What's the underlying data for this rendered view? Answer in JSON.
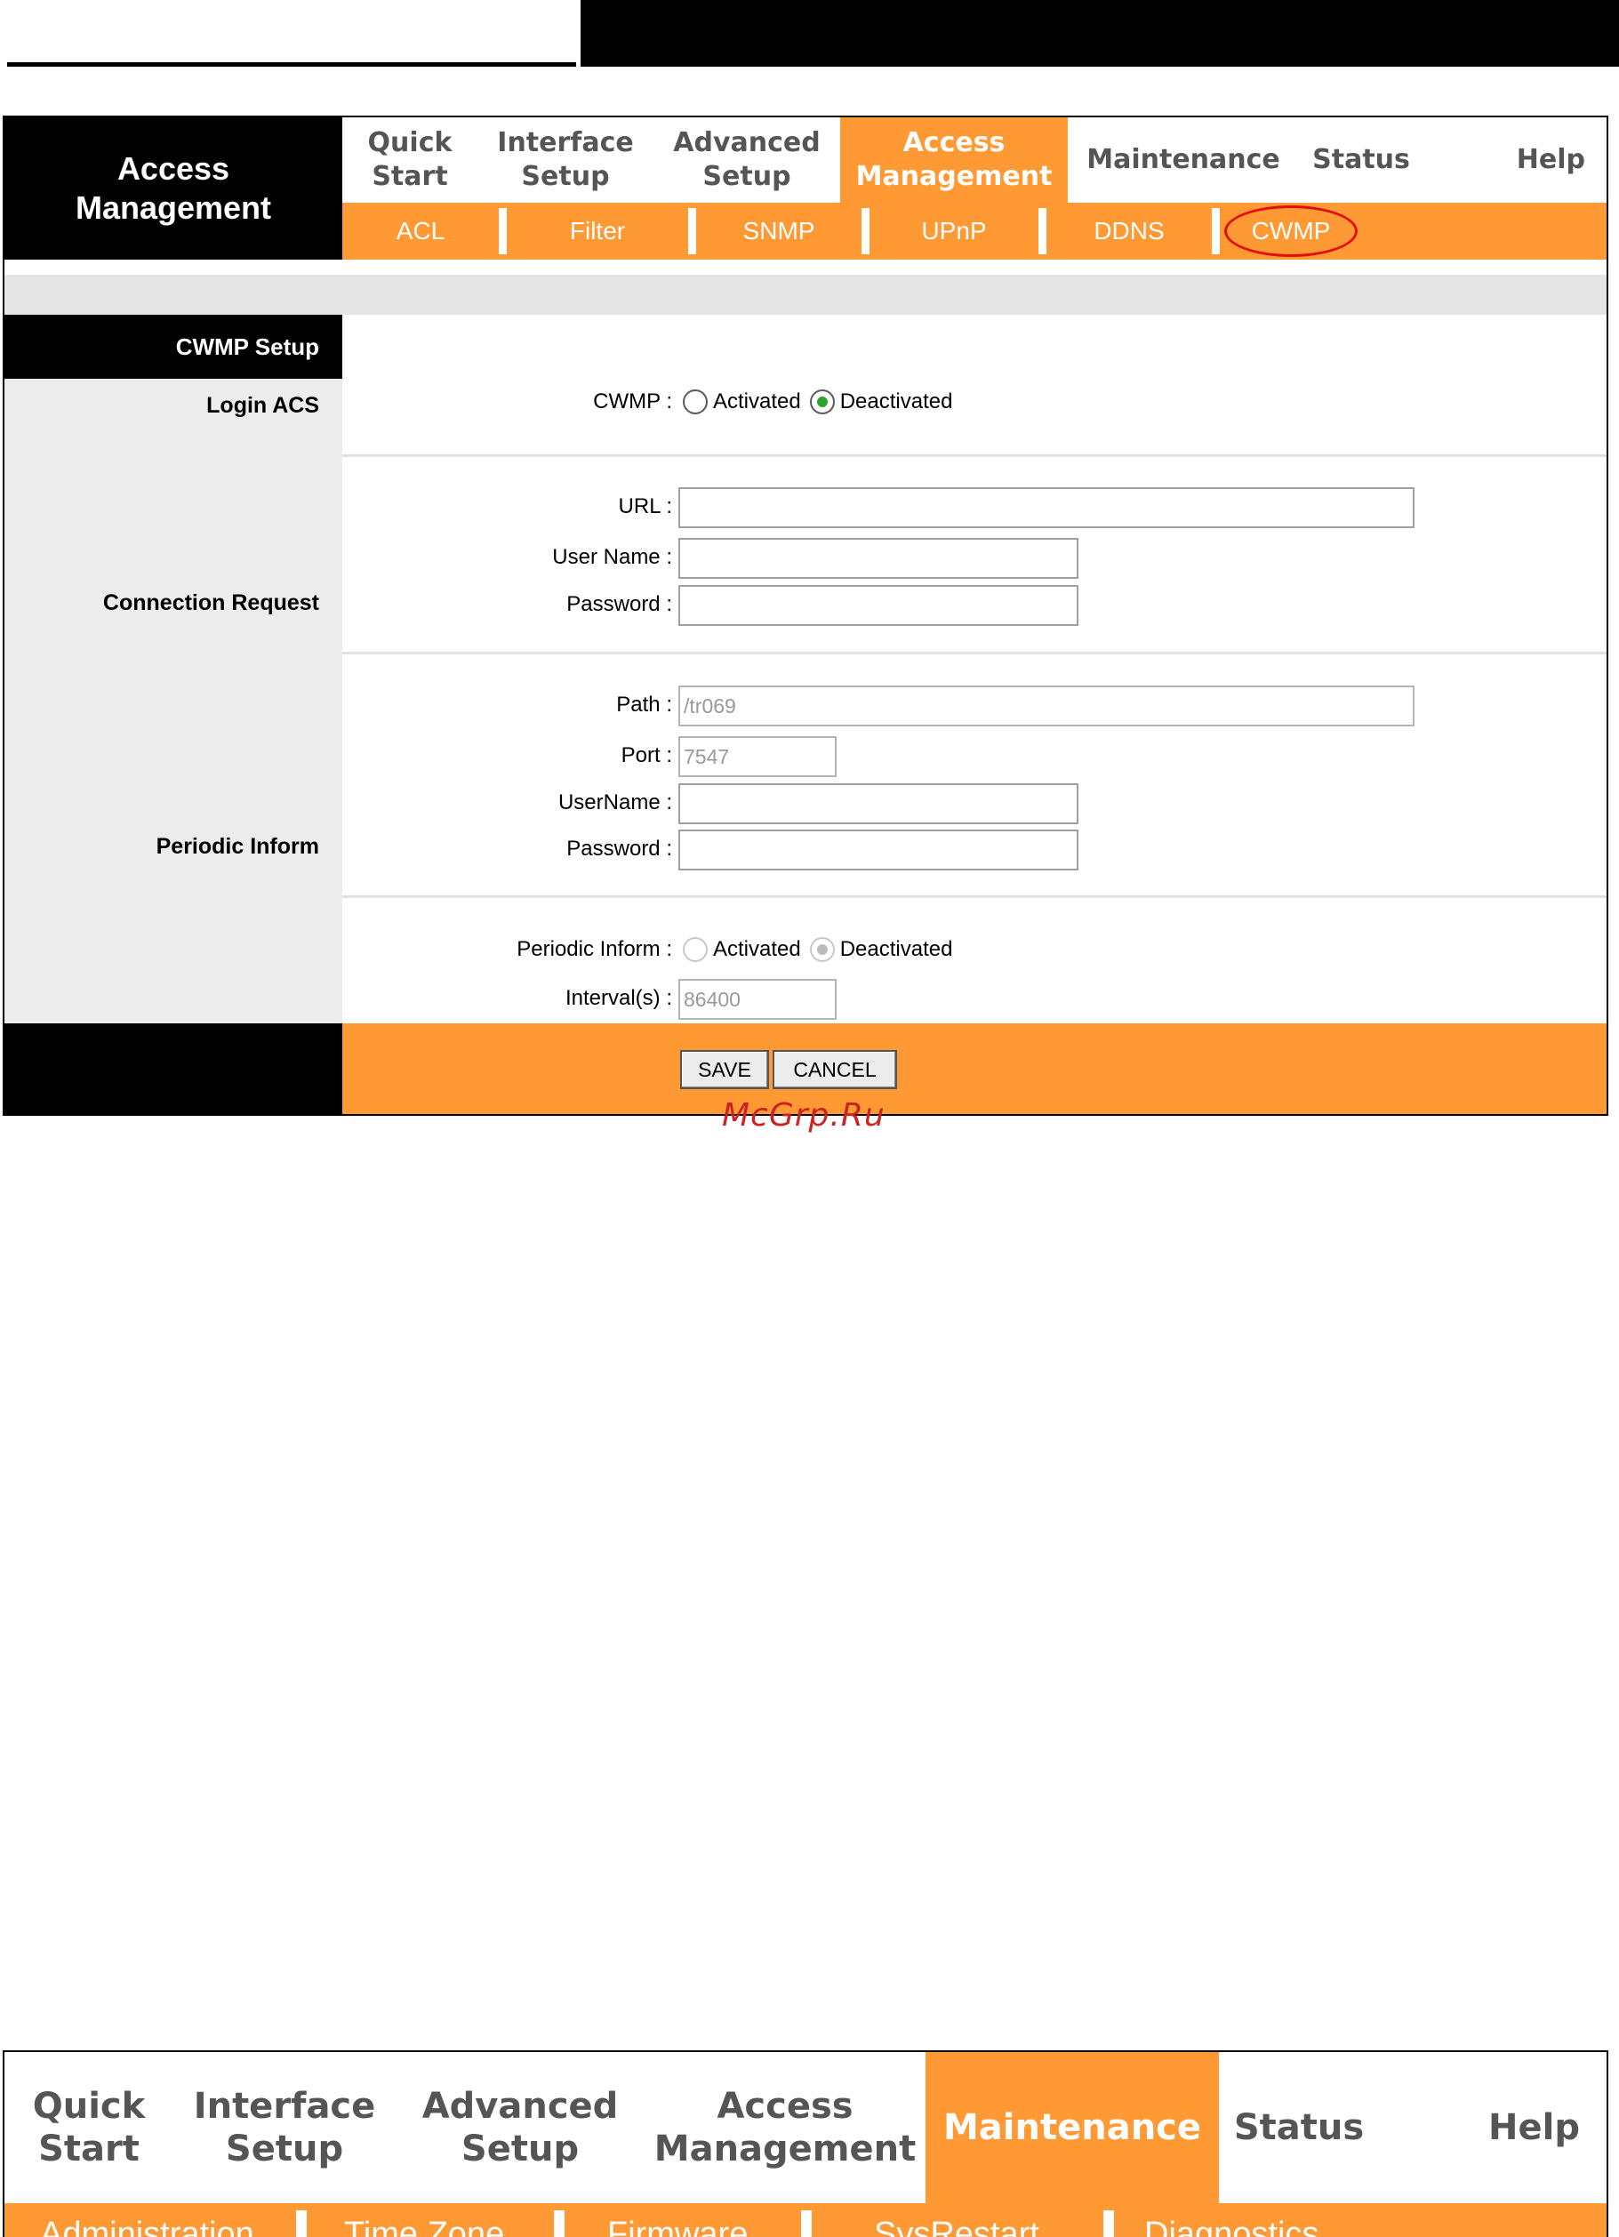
{
  "colors": {
    "accent": "#ff9933",
    "header_black": "#000000",
    "panel_gray": "#ececec",
    "highlight_circle": "#e01010",
    "watermark": "#cc2222"
  },
  "screen1": {
    "brand": {
      "line1": "Access",
      "line2": "Management"
    },
    "main_tabs": [
      {
        "line1": "Quick",
        "line2": "Start"
      },
      {
        "line1": "Interface",
        "line2": "Setup"
      },
      {
        "line1": "Advanced",
        "line2": "Setup"
      },
      {
        "line1": "Access",
        "line2": "Management",
        "active": true
      },
      {
        "line1": "Maintenance",
        "line2": ""
      },
      {
        "line1": "Status",
        "line2": ""
      },
      {
        "line1": "Help",
        "line2": ""
      }
    ],
    "sub_tabs": [
      "ACL",
      "Filter",
      "SNMP",
      "UPnP",
      "DDNS",
      "CWMP"
    ],
    "active_sub_tab": "CWMP",
    "panel_title": "CWMP Setup",
    "cwmp": {
      "label": "CWMP :",
      "options": [
        "Activated",
        "Deactivated"
      ],
      "selected": "Deactivated"
    },
    "login_acs": {
      "section": "Login ACS",
      "url_label": "URL :",
      "url_value": "",
      "username_label": "User Name :",
      "username_value": "",
      "password_label": "Password :",
      "password_value": ""
    },
    "connection_request": {
      "section": "Connection Request",
      "path_label": "Path :",
      "path_value": "/tr069",
      "port_label": "Port :",
      "port_value": "7547",
      "username_label": "UserName :",
      "username_value": "",
      "password_label": "Password :",
      "password_value": ""
    },
    "periodic_inform": {
      "section": "Periodic Inform",
      "label": "Periodic Inform :",
      "options": [
        "Activated",
        "Deactivated"
      ],
      "selected": "Deactivated",
      "interval_label": "Interval(s) :",
      "interval_value": "86400"
    },
    "buttons": {
      "save": "SAVE",
      "cancel": "CANCEL"
    }
  },
  "watermark": "McGrp.Ru",
  "screen2": {
    "main_tabs": [
      {
        "line1": "Quick",
        "line2": "Start"
      },
      {
        "line1": "Interface",
        "line2": "Setup"
      },
      {
        "line1": "Advanced",
        "line2": "Setup"
      },
      {
        "line1": "Access",
        "line2": "Management"
      },
      {
        "line1": "Maintenance",
        "line2": "",
        "active": true
      },
      {
        "line1": "Status",
        "line2": ""
      },
      {
        "line1": "Help",
        "line2": ""
      }
    ],
    "sub_tabs": [
      "Administration",
      "Time Zone",
      "Firmware",
      "SysRestart",
      "Diagnostics"
    ]
  }
}
